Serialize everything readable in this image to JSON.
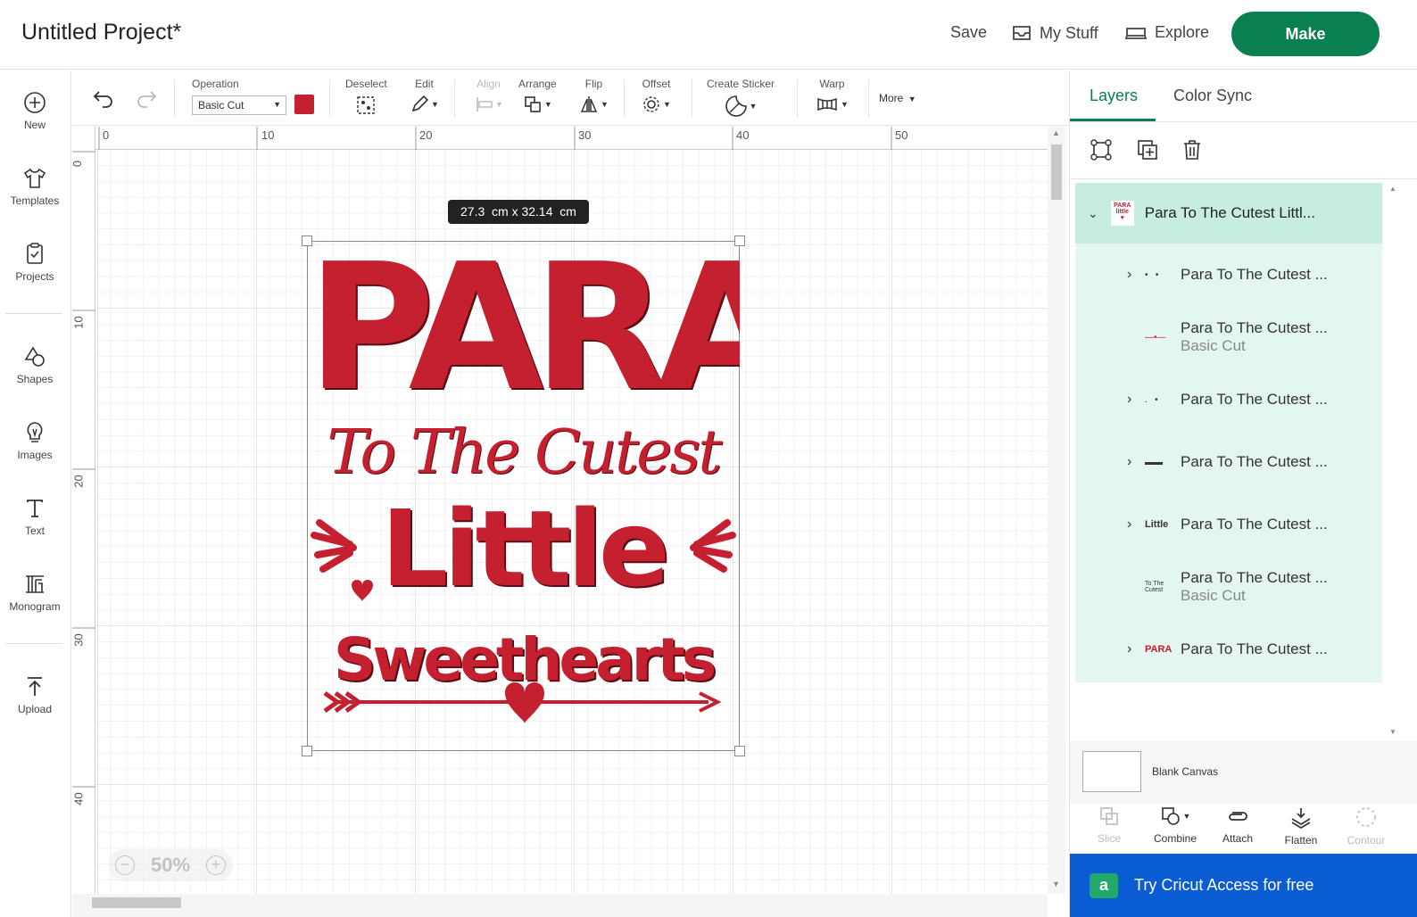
{
  "header": {
    "title": "Untitled Project*",
    "save_label": "Save",
    "my_stuff_label": "My Stuff",
    "explore_label": "Explore",
    "make_label": "Make"
  },
  "leftnav": {
    "items": [
      {
        "label": "New",
        "icon": "plus-circle-icon"
      },
      {
        "label": "Templates",
        "icon": "shirt-icon"
      },
      {
        "label": "Projects",
        "icon": "projects-icon"
      },
      {
        "label": "Shapes",
        "icon": "shapes-icon"
      },
      {
        "label": "Images",
        "icon": "lightbulb-icon"
      },
      {
        "label": "Text",
        "icon": "text-icon"
      },
      {
        "label": "Monogram",
        "icon": "monogram-icon"
      },
      {
        "label": "Upload",
        "icon": "upload-icon"
      }
    ]
  },
  "toolbar": {
    "operation_label": "Operation",
    "operation_value": "Basic Cut",
    "operation_color": "#c5202f",
    "deselect_label": "Deselect",
    "edit_label": "Edit",
    "align_label": "Align",
    "arrange_label": "Arrange",
    "flip_label": "Flip",
    "offset_label": "Offset",
    "create_sticker_label": "Create Sticker",
    "warp_label": "Warp",
    "more_label": "More"
  },
  "canvas": {
    "ruler_top": [
      "0",
      "10",
      "20",
      "30",
      "40",
      "50"
    ],
    "ruler_left": [
      "0",
      "10",
      "20",
      "30",
      "40"
    ],
    "size_tooltip": "27.3  cm x 32.14  cm",
    "zoom": "50%",
    "design": {
      "line1": "PARA",
      "line2": "To The Cutest",
      "line3": "Little",
      "line4": "Sweethearts",
      "color": "#c5202f"
    }
  },
  "rpanel": {
    "tab_layers": "Layers",
    "tab_color_sync": "Color Sync",
    "group_title": "Para To The Cutest Littl...",
    "layers": [
      {
        "name": "Para To The Cutest ...",
        "sub": "",
        "expandable": true
      },
      {
        "name": "Para To The Cutest ...",
        "sub": "Basic Cut",
        "expandable": false
      },
      {
        "name": "Para To The Cutest ...",
        "sub": "",
        "expandable": true
      },
      {
        "name": "Para To The Cutest ...",
        "sub": "",
        "expandable": true
      },
      {
        "name": "Para To The Cutest ...",
        "sub": "",
        "expandable": true
      },
      {
        "name": "Para To The Cutest ...",
        "sub": "Basic Cut",
        "expandable": false
      },
      {
        "name": "Para To The Cutest ...",
        "sub": "",
        "expandable": true
      }
    ],
    "blank_canvas_label": "Blank Canvas",
    "tools": {
      "slice": "Slice",
      "combine": "Combine",
      "attach": "Attach",
      "flatten": "Flatten",
      "contour": "Contour"
    },
    "promo_label": "Try Cricut Access for free"
  },
  "colors": {
    "accent": "#0a7f4f",
    "layer_bg": "#e3f6ef",
    "layer_group_bg": "#c6ede0",
    "promo_bg": "#0a5cd3",
    "design_red": "#c5202f"
  }
}
